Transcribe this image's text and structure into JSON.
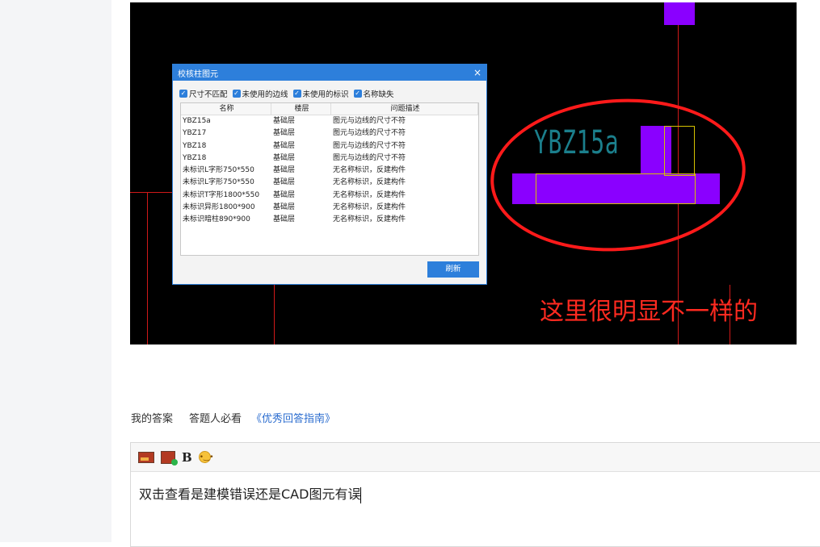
{
  "cad_image": {
    "dialog": {
      "title": "校核柱图元",
      "checkboxes": [
        {
          "label": "尺寸不匹配",
          "checked": true
        },
        {
          "label": "未使用的边线",
          "checked": true
        },
        {
          "label": "未使用的标识",
          "checked": true
        },
        {
          "label": "名称缺失",
          "checked": true
        }
      ],
      "columns": [
        "名称",
        "楼层",
        "问题描述"
      ],
      "rows": [
        [
          "YBZ15a",
          "基础层",
          "图元与边线的尺寸不符"
        ],
        [
          "YBZ17",
          "基础层",
          "图元与边线的尺寸不符"
        ],
        [
          "YBZ18",
          "基础层",
          "图元与边线的尺寸不符"
        ],
        [
          "YBZ18",
          "基础层",
          "图元与边线的尺寸不符"
        ],
        [
          "未标识L字形750*550",
          "基础层",
          "无名称标识，反建构件"
        ],
        [
          "未标识L字形750*550",
          "基础层",
          "无名称标识，反建构件"
        ],
        [
          "未标识T字形1800*550",
          "基础层",
          "无名称标识，反建构件"
        ],
        [
          "未标识异形1800*900",
          "基础层",
          "无名称标识，反建构件"
        ],
        [
          "未标识暗柱890*900",
          "基础层",
          "无名称标识，反建构件"
        ]
      ],
      "refresh_label": "刷新",
      "close_glyph": "×"
    },
    "element_label": "YBZ15a",
    "annotation": "这里很明显不一样的",
    "colors": {
      "element_fill": "#8a00ff",
      "grid_line": "#d01919",
      "annotation": "#ff2a20",
      "dialog_accent": "#2d7fdb"
    }
  },
  "answer": {
    "my_answer_label": "我的答案",
    "must_read_label": "答题人必看",
    "guide_link": "《优秀回答指南》",
    "toolbar": {
      "icons": [
        "image-icon",
        "image-upload-icon",
        "bold-icon",
        "emoji-icon"
      ],
      "bold_label": "B"
    },
    "editor_text": "双击查看是建模错误还是CAD图元有误"
  }
}
